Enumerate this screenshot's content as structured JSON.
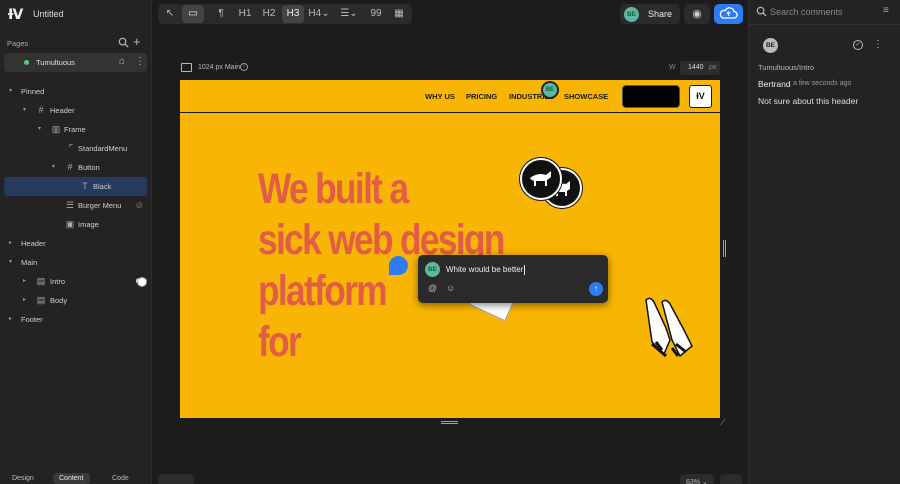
{
  "app": {
    "logo": "ƗV",
    "title": "Untitled"
  },
  "sidebar": {
    "pages_label": "Pages",
    "page": {
      "name": "Tumultuous"
    },
    "tree": [
      {
        "label": "Pinned",
        "icon": "",
        "caret": "▾"
      },
      {
        "label": "Header",
        "icon": "#",
        "caret": "▾"
      },
      {
        "label": "Frame",
        "icon": "▥",
        "caret": "▾"
      },
      {
        "label": "StandardMenu",
        "icon": "⌜",
        "caret": ""
      },
      {
        "label": "Button",
        "icon": "#",
        "caret": "▾"
      },
      {
        "label": "Black",
        "icon": "T",
        "caret": ""
      },
      {
        "label": "Burger Menu",
        "icon": "☰",
        "caret": ""
      },
      {
        "label": "Image",
        "icon": "▣",
        "caret": ""
      },
      {
        "label": "Header",
        "icon": "",
        "caret": "▸"
      },
      {
        "label": "Main",
        "icon": "",
        "caret": "▾"
      },
      {
        "label": "Intro",
        "icon": "▤",
        "caret": "▸"
      },
      {
        "label": "Body",
        "icon": "▤",
        "caret": "▸"
      },
      {
        "label": "Footer",
        "icon": "",
        "caret": "▸"
      }
    ],
    "bottom_tabs": [
      "Design",
      "Content",
      "Code"
    ]
  },
  "toolbar": {
    "items": [
      "↖",
      "▭",
      "¶",
      "H1",
      "H2",
      "H3",
      "H4⌄",
      "☰⌄",
      "99",
      "▦"
    ]
  },
  "topbar": {
    "share_label": "Share",
    "avatar_initials": "BE"
  },
  "canvas": {
    "frame_label": "1024 px Main",
    "width_label": "W",
    "width_value": "1440",
    "width_unit": "px",
    "zoom_label": "63% ⌄"
  },
  "site": {
    "nav": [
      "WHY US",
      "PRICING",
      "INDUSTRIES",
      "SHOWCASE"
    ],
    "logo": "ƗV",
    "hero_lines": [
      "We built a",
      "sick web design",
      "platform",
      "for"
    ]
  },
  "comment_popover": {
    "draft_text": "White would be better",
    "avatar_initials": "BE"
  },
  "comments_panel": {
    "search_placeholder": "Search comments",
    "thread": {
      "avatar_initials": "BE",
      "path": "Tumultuous/Intro",
      "author": "Bertrand",
      "time": "a few seconds ago",
      "text": "Not sure about this header"
    }
  },
  "colors": {
    "site_background": "#f9b504",
    "hero_text": "#e25d46",
    "accent_blue": "#2d7cf6",
    "selection": "#26395e"
  }
}
